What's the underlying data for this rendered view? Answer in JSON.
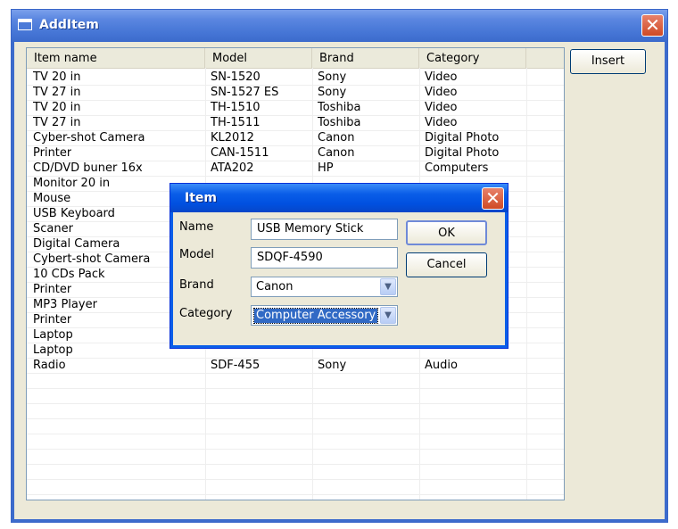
{
  "window": {
    "title": "AddItem",
    "close_label": "✕"
  },
  "toolbar": {
    "insert_label": "Insert"
  },
  "table": {
    "columns": [
      "Item name",
      "Model",
      "Brand",
      "Category"
    ],
    "rows": [
      [
        "TV 20 in",
        "SN-1520",
        "Sony",
        "Video"
      ],
      [
        "TV 27 in",
        "SN-1527 ES",
        "Sony",
        "Video"
      ],
      [
        "TV 20 in",
        "TH-1510",
        "Toshiba",
        "Video"
      ],
      [
        "TV 27 in",
        "TH-1511",
        "Toshiba",
        "Video"
      ],
      [
        "Cyber-shot Camera",
        "KL2012",
        "Canon",
        "Digital Photo"
      ],
      [
        "Printer",
        "CAN-1511",
        "Canon",
        "Digital Photo"
      ],
      [
        "CD/DVD buner 16x",
        "ATA202",
        "HP",
        "Computers"
      ],
      [
        "Monitor 20 in",
        "",
        "",
        ""
      ],
      [
        "Mouse",
        "",
        "",
        ""
      ],
      [
        "USB Keyboard",
        "",
        "",
        ""
      ],
      [
        "Scaner",
        "",
        "",
        ""
      ],
      [
        "Digital Camera",
        "",
        "",
        ""
      ],
      [
        "Cybert-shot Camera",
        "",
        "",
        ""
      ],
      [
        "10 CDs Pack",
        "",
        "",
        ""
      ],
      [
        "Printer",
        "",
        "",
        ""
      ],
      [
        "MP3 Player",
        "",
        "",
        ""
      ],
      [
        "Printer",
        "",
        "",
        ""
      ],
      [
        "Laptop",
        "",
        "",
        ""
      ],
      [
        "Laptop",
        "",
        "",
        ""
      ],
      [
        "Radio",
        "SDF-455",
        "Sony",
        "Audio"
      ]
    ]
  },
  "dialog": {
    "title": "Item",
    "close_label": "✕",
    "name_label": "Name",
    "name_value": "USB Memory Stick",
    "model_label": "Model",
    "model_value": "SDQF-4590",
    "brand_label": "Brand",
    "brand_value": "Canon",
    "category_label": "Category",
    "category_value": "Computer Accessory",
    "ok_label": "OK",
    "cancel_label": "Cancel"
  },
  "icons": {
    "window_icon": "window-icon",
    "close": "close-icon",
    "dropdown": "chevron-down-icon"
  },
  "colors": {
    "title_bar": "#4676d6",
    "dialog_title_bar": "#0050e0",
    "close_button": "#cf4a25",
    "selection": "#316ac5",
    "window_bg": "#ece9d8"
  }
}
